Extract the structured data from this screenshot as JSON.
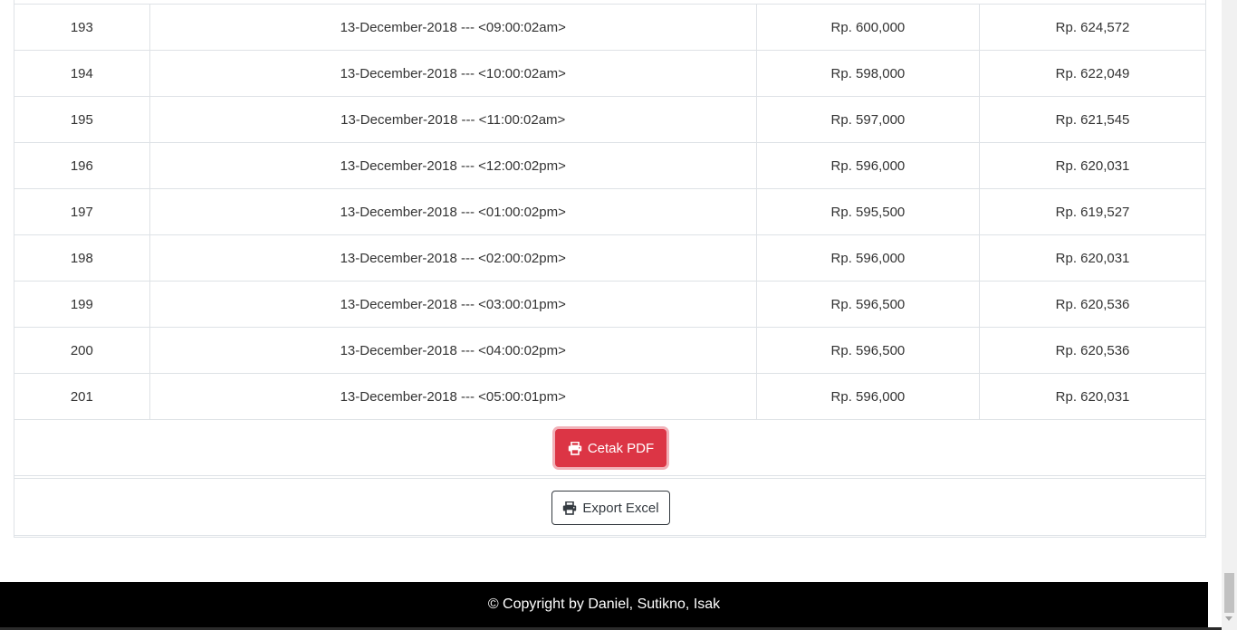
{
  "table": {
    "rows": [
      {
        "no": "193",
        "datetime": "13-December-2018 --- <09:00:02am>",
        "price_a": "Rp. 600,000",
        "price_b": "Rp. 624,572"
      },
      {
        "no": "194",
        "datetime": "13-December-2018 --- <10:00:02am>",
        "price_a": "Rp. 598,000",
        "price_b": "Rp. 622,049"
      },
      {
        "no": "195",
        "datetime": "13-December-2018 --- <11:00:02am>",
        "price_a": "Rp. 597,000",
        "price_b": "Rp. 621,545"
      },
      {
        "no": "196",
        "datetime": "13-December-2018 --- <12:00:02pm>",
        "price_a": "Rp. 596,000",
        "price_b": "Rp. 620,031"
      },
      {
        "no": "197",
        "datetime": "13-December-2018 --- <01:00:02pm>",
        "price_a": "Rp. 595,500",
        "price_b": "Rp. 619,527"
      },
      {
        "no": "198",
        "datetime": "13-December-2018 --- <02:00:02pm>",
        "price_a": "Rp. 596,000",
        "price_b": "Rp. 620,031"
      },
      {
        "no": "199",
        "datetime": "13-December-2018 --- <03:00:01pm>",
        "price_a": "Rp. 596,500",
        "price_b": "Rp. 620,536"
      },
      {
        "no": "200",
        "datetime": "13-December-2018 --- <04:00:02pm>",
        "price_a": "Rp. 596,500",
        "price_b": "Rp. 620,536"
      },
      {
        "no": "201",
        "datetime": "13-December-2018 --- <05:00:01pm>",
        "price_a": "Rp. 596,000",
        "price_b": "Rp. 620,031"
      }
    ]
  },
  "actions": {
    "pdf_label": "Cetak PDF",
    "pdf_icon": "printer-icon",
    "excel_label": "Export Excel",
    "excel_icon": "printer-icon"
  },
  "footer": {
    "copyright": "© Copyright by Daniel, Sutikno, Isak"
  },
  "colors": {
    "danger": "#dc3545",
    "footer_bg": "#000000",
    "border": "#dee2e6"
  }
}
